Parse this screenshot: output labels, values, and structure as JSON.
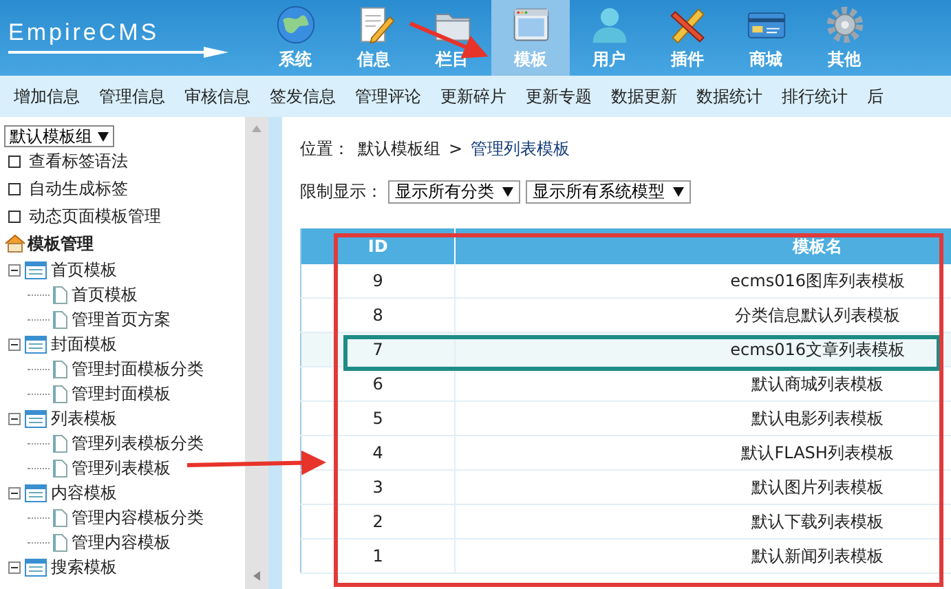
{
  "logo": "EmpireCMS",
  "nav": [
    {
      "label": "系统",
      "selected": false
    },
    {
      "label": "信息",
      "selected": false
    },
    {
      "label": "栏目",
      "selected": false
    },
    {
      "label": "模板",
      "selected": true
    },
    {
      "label": "用户",
      "selected": false
    },
    {
      "label": "插件",
      "selected": false
    },
    {
      "label": "商城",
      "selected": false
    },
    {
      "label": "其他",
      "selected": false
    }
  ],
  "submenu": [
    "增加信息",
    "管理信息",
    "审核信息",
    "签发信息",
    "管理评论",
    "更新碎片",
    "更新专题",
    "数据更新",
    "数据统计",
    "排行统计",
    "后"
  ],
  "sidebar": {
    "group_select": "默认模板组",
    "links": [
      "查看标签语法",
      "自动生成标签",
      "动态页面模板管理"
    ],
    "tree": {
      "label": "模板管理",
      "children": [
        {
          "label": "首页模板",
          "expanded": true,
          "children": [
            {
              "label": "首页模板"
            },
            {
              "label": "管理首页方案"
            }
          ]
        },
        {
          "label": "封面模板",
          "expanded": true,
          "children": [
            {
              "label": "管理封面模板分类"
            },
            {
              "label": "管理封面模板"
            }
          ]
        },
        {
          "label": "列表模板",
          "expanded": true,
          "children": [
            {
              "label": "管理列表模板分类"
            },
            {
              "label": "管理列表模板"
            }
          ]
        },
        {
          "label": "内容模板",
          "expanded": true,
          "children": [
            {
              "label": "管理内容模板分类"
            },
            {
              "label": "管理内容模板"
            }
          ]
        },
        {
          "label": "搜索模板",
          "expanded": true
        }
      ]
    }
  },
  "breadcrumb": {
    "label": "位置：",
    "items": [
      "默认模板组",
      "管理列表模板"
    ],
    "separator": ">"
  },
  "filter": {
    "label": "限制显示：",
    "selects": [
      "显示所有分类",
      "显示所有系统模型"
    ]
  },
  "table": {
    "columns": [
      "ID",
      "模板名"
    ],
    "rows": [
      {
        "id": "9",
        "name": "ecms016图库列表模板",
        "selected": false
      },
      {
        "id": "8",
        "name": "分类信息默认列表模板",
        "selected": false
      },
      {
        "id": "7",
        "name": "ecms016文章列表模板",
        "selected": true
      },
      {
        "id": "6",
        "name": "默认商城列表模板",
        "selected": false
      },
      {
        "id": "5",
        "name": "默认电影列表模板",
        "selected": false
      },
      {
        "id": "4",
        "name": "默认FLASH列表模板",
        "selected": false
      },
      {
        "id": "3",
        "name": "默认图片列表模板",
        "selected": false
      },
      {
        "id": "2",
        "name": "默认下载列表模板",
        "selected": false
      },
      {
        "id": "1",
        "name": "默认新闻列表模板",
        "selected": false
      }
    ]
  }
}
